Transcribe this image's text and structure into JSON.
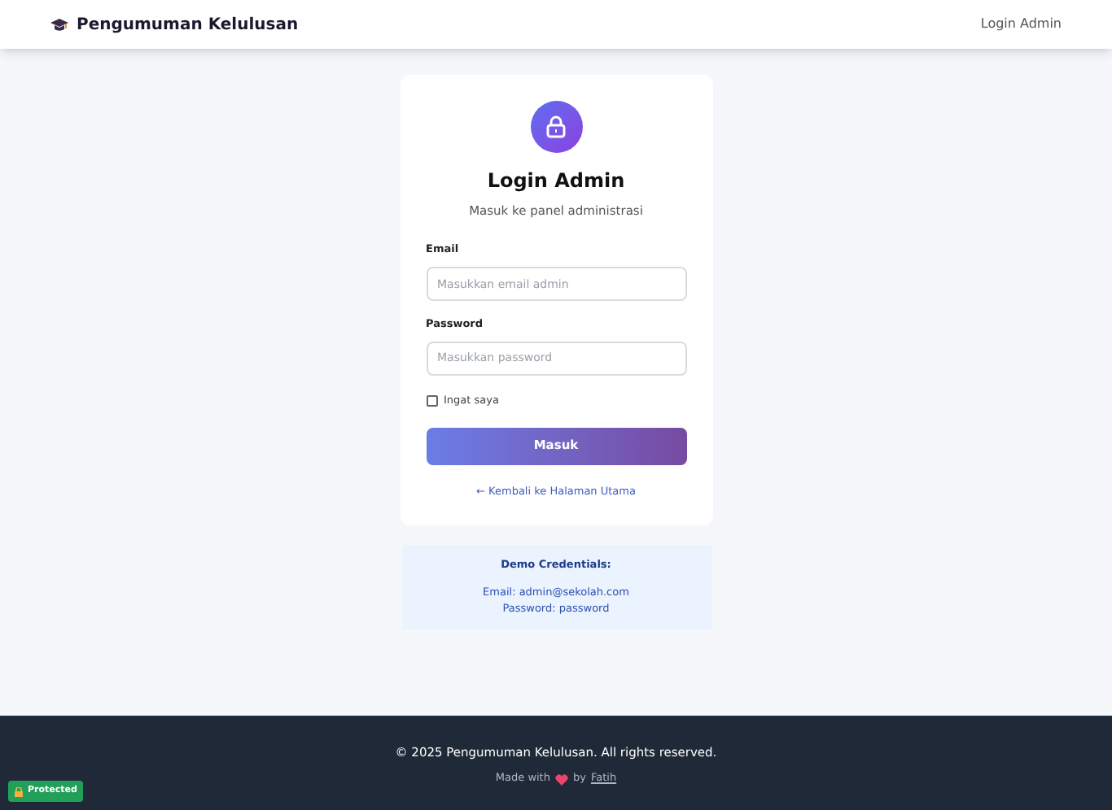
{
  "navbar": {
    "brand": "Pengumuman Kelulusan",
    "link": "Login Admin"
  },
  "login": {
    "title": "Login Admin",
    "subtitle": "Masuk ke panel administrasi",
    "fields": [
      {
        "label": "Email",
        "placeholder": "Masukkan email admin"
      },
      {
        "label": "Password",
        "placeholder": "Masukkan password"
      }
    ],
    "remember": {
      "label": "Ingat saya",
      "checked": false
    },
    "submit": "Masuk",
    "back_link": "← Kembali ke Halaman Utama"
  },
  "demo": {
    "title": "Demo Credentials:",
    "lines": [
      "Email: admin@sekolah.com",
      "Password: password"
    ]
  },
  "footer": {
    "copyright": "© 2025 Pengumuman Kelulusan. All rights reserved.",
    "made_with": "Made with",
    "by": "by",
    "author": "Fatih"
  },
  "badge": {
    "label": "Protected"
  }
}
